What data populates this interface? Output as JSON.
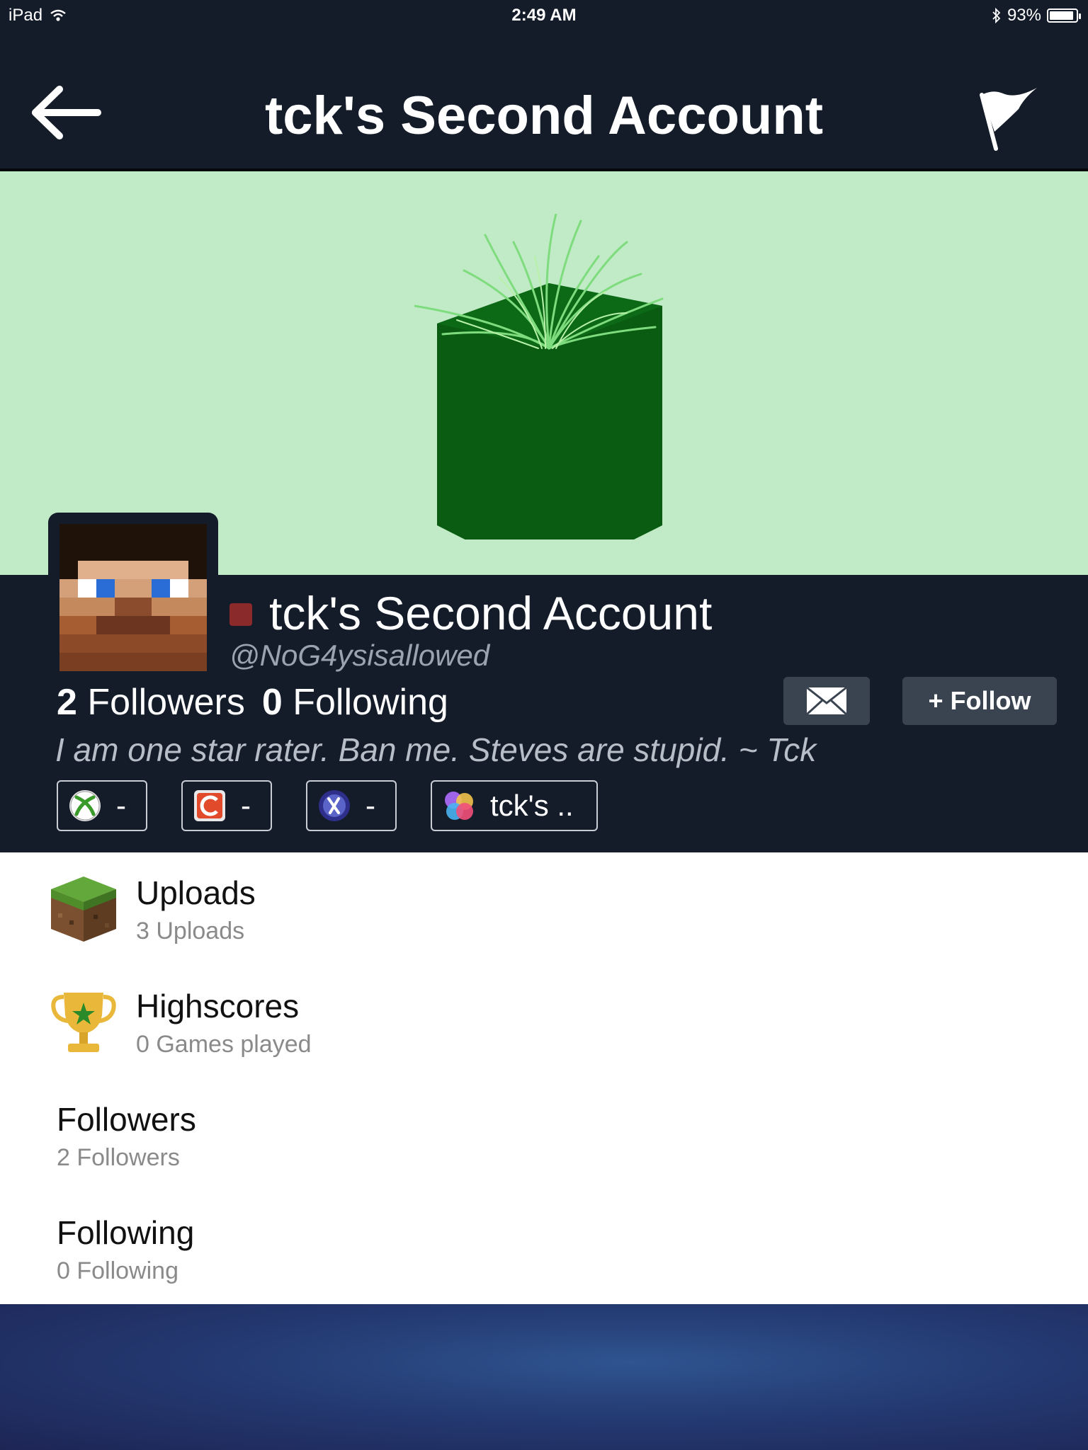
{
  "status_bar": {
    "device": "iPad",
    "time": "2:49 AM",
    "battery": "93%",
    "battery_level": 0.93
  },
  "nav": {
    "title": "tck's Second Account",
    "back_icon": "arrow-left-icon",
    "report_icon": "flag-icon"
  },
  "profile": {
    "display_name": "tck's Second Account",
    "handle": "@NoG4ysisallowed",
    "online_status_color": "#8b2a2a",
    "followers_count": "2",
    "followers_label": "Followers",
    "following_count": "0",
    "following_label": "Following",
    "bio": "I am one star rater. Ban me. Steves are stupid. ~ Tck",
    "message_icon": "envelope-icon",
    "follow_label": "+ Follow"
  },
  "linked_accounts": [
    {
      "icon": "xbox-icon",
      "value": "-"
    },
    {
      "icon": "origin-icon",
      "value": "-"
    },
    {
      "icon": "playstation-icon",
      "value": "-"
    },
    {
      "icon": "game-center-icon",
      "value": "tck's .."
    }
  ],
  "menu": [
    {
      "title": "Uploads",
      "subtitle": "3 Uploads",
      "icon": "grass-block-icon"
    },
    {
      "title": "Highscores",
      "subtitle": "0 Games played",
      "icon": "trophy-icon"
    },
    {
      "title": "Followers",
      "subtitle": "2 Followers"
    },
    {
      "title": "Following",
      "subtitle": "0 Following"
    }
  ],
  "colors": {
    "header_bg": "#141c2a",
    "cover_bg": "#c0ebc6",
    "cube_green": "#0a5c12"
  }
}
